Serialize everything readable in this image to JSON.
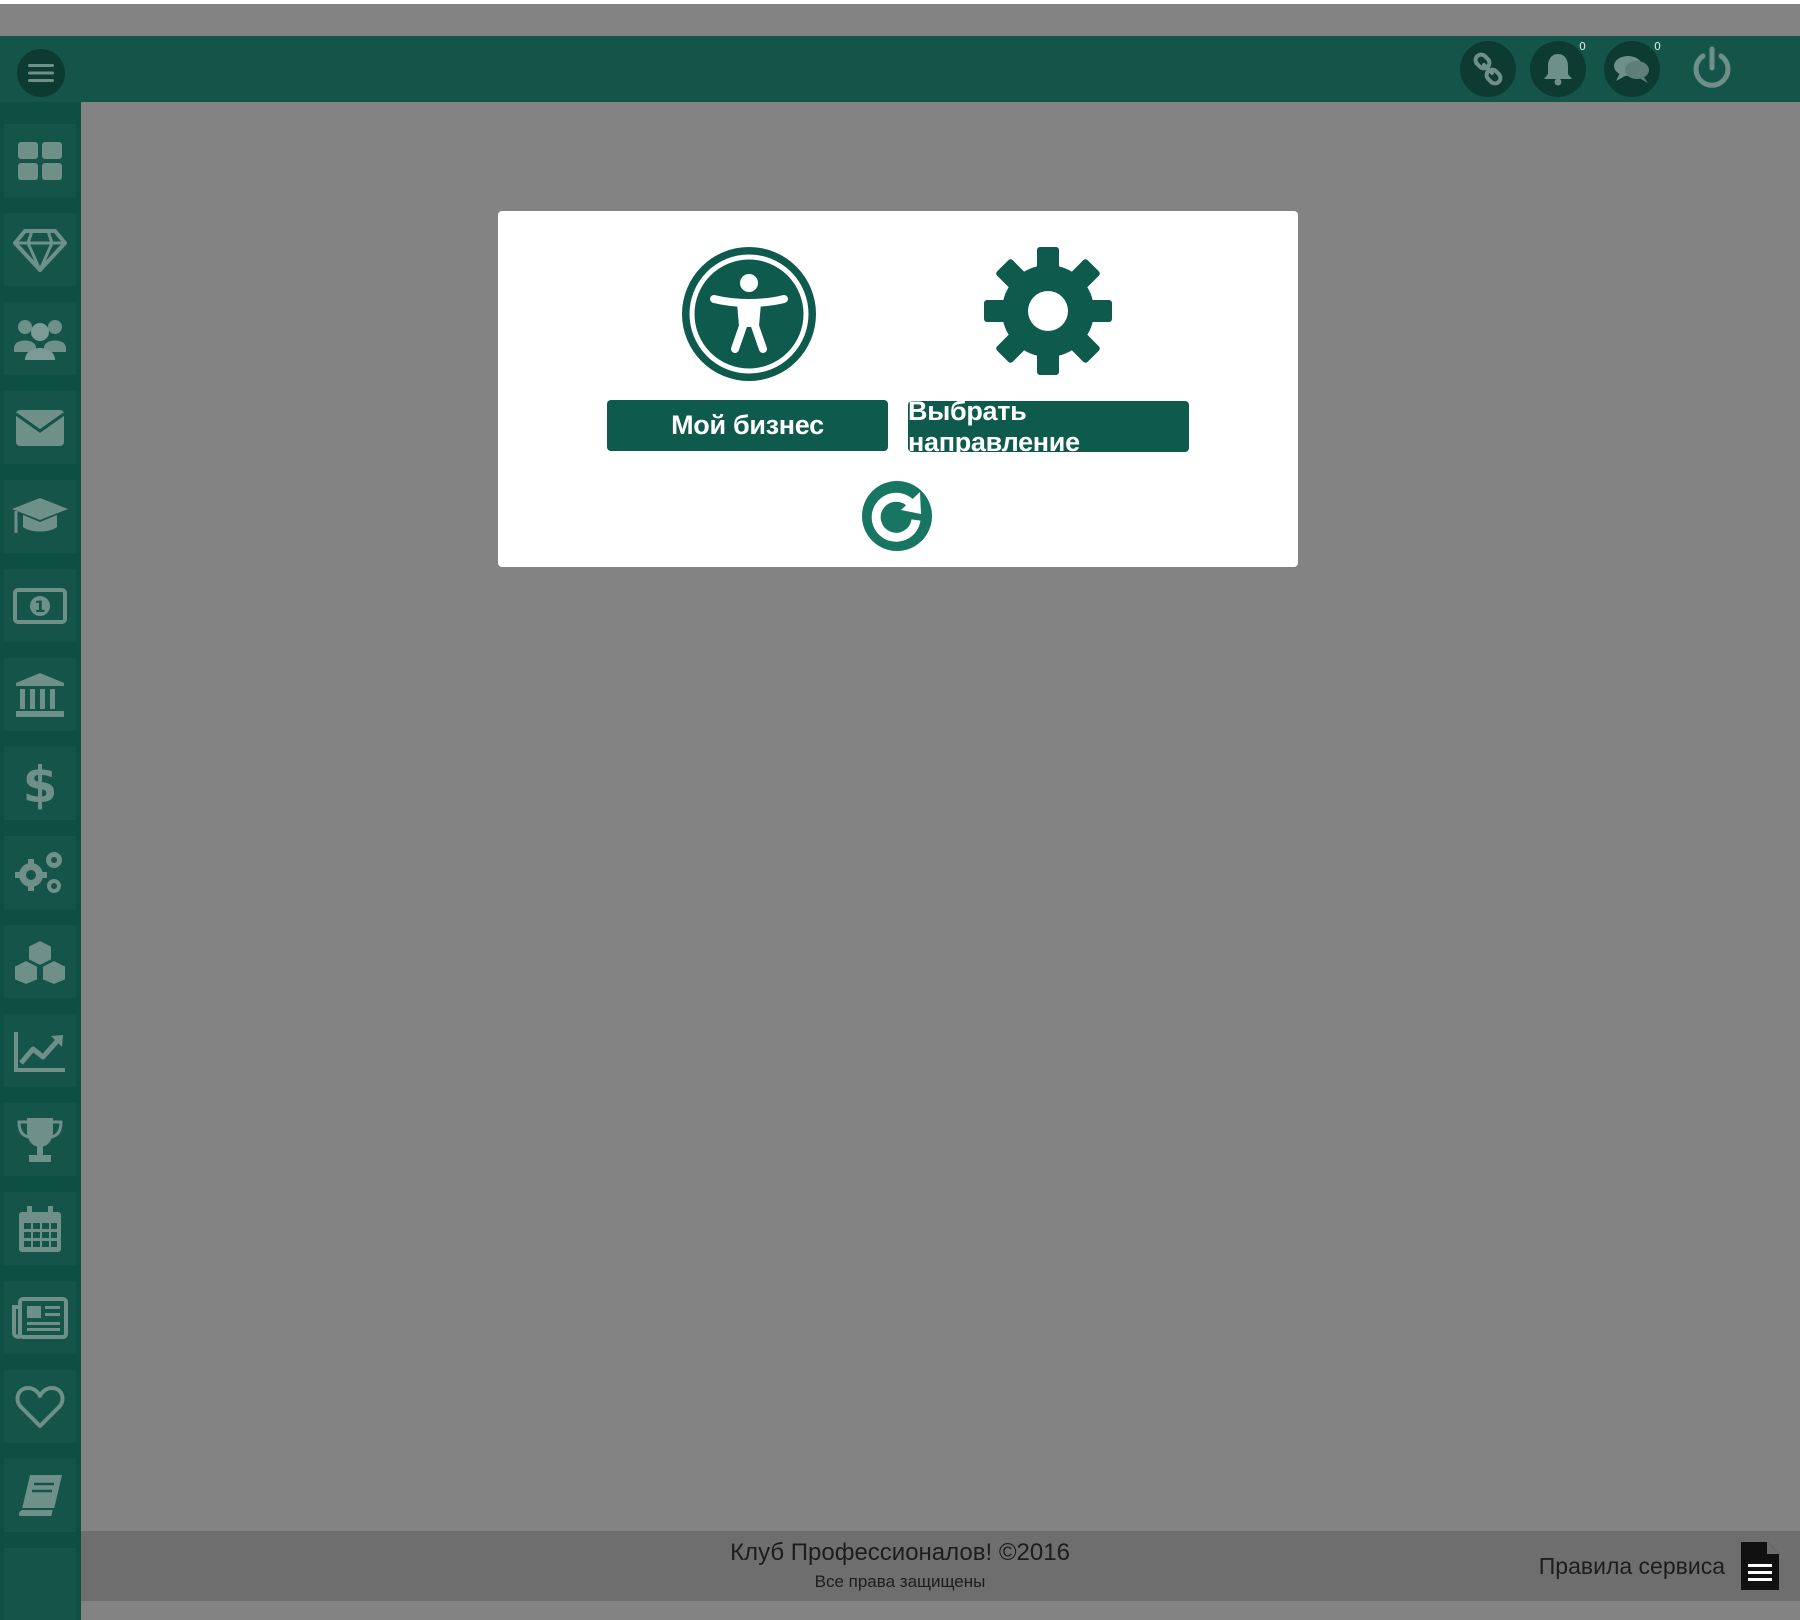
{
  "topbar": {
    "menu_icon": "hamburger-menu-icon",
    "icons": [
      {
        "name": "link-icon",
        "badge": ""
      },
      {
        "name": "bell-icon",
        "badge": "0"
      },
      {
        "name": "chat-icon",
        "badge": "0"
      },
      {
        "name": "power-icon",
        "badge": ""
      }
    ]
  },
  "sidebar": {
    "items": [
      "dashboard-grid-icon",
      "diamond-icon",
      "users-group-icon",
      "envelope-icon",
      "graduation-cap-icon",
      "money-bill-icon",
      "bank-building-icon",
      "dollar-icon",
      "gears-icon",
      "cubes-icon",
      "line-chart-icon",
      "trophy-icon",
      "calendar-icon",
      "newspaper-icon",
      "heart-icon",
      "book-icon",
      "blank-item"
    ]
  },
  "modal": {
    "my_business_label": "Мой бизнес",
    "choose_direction_label": "Выбрать направление",
    "my_business_icon": "accessibility-person-icon",
    "choose_direction_icon": "gear-icon",
    "refresh_icon": "refresh-icon"
  },
  "footer": {
    "copyright": "Клуб Профессионалов! ©2016",
    "rights": "Все права защищены",
    "rules_label": "Правила сервиса",
    "rules_icon": "document-icon"
  },
  "colors": {
    "brand_dark": "#155449",
    "brand_button": "#0e5a4c",
    "backdrop": "#838383"
  }
}
